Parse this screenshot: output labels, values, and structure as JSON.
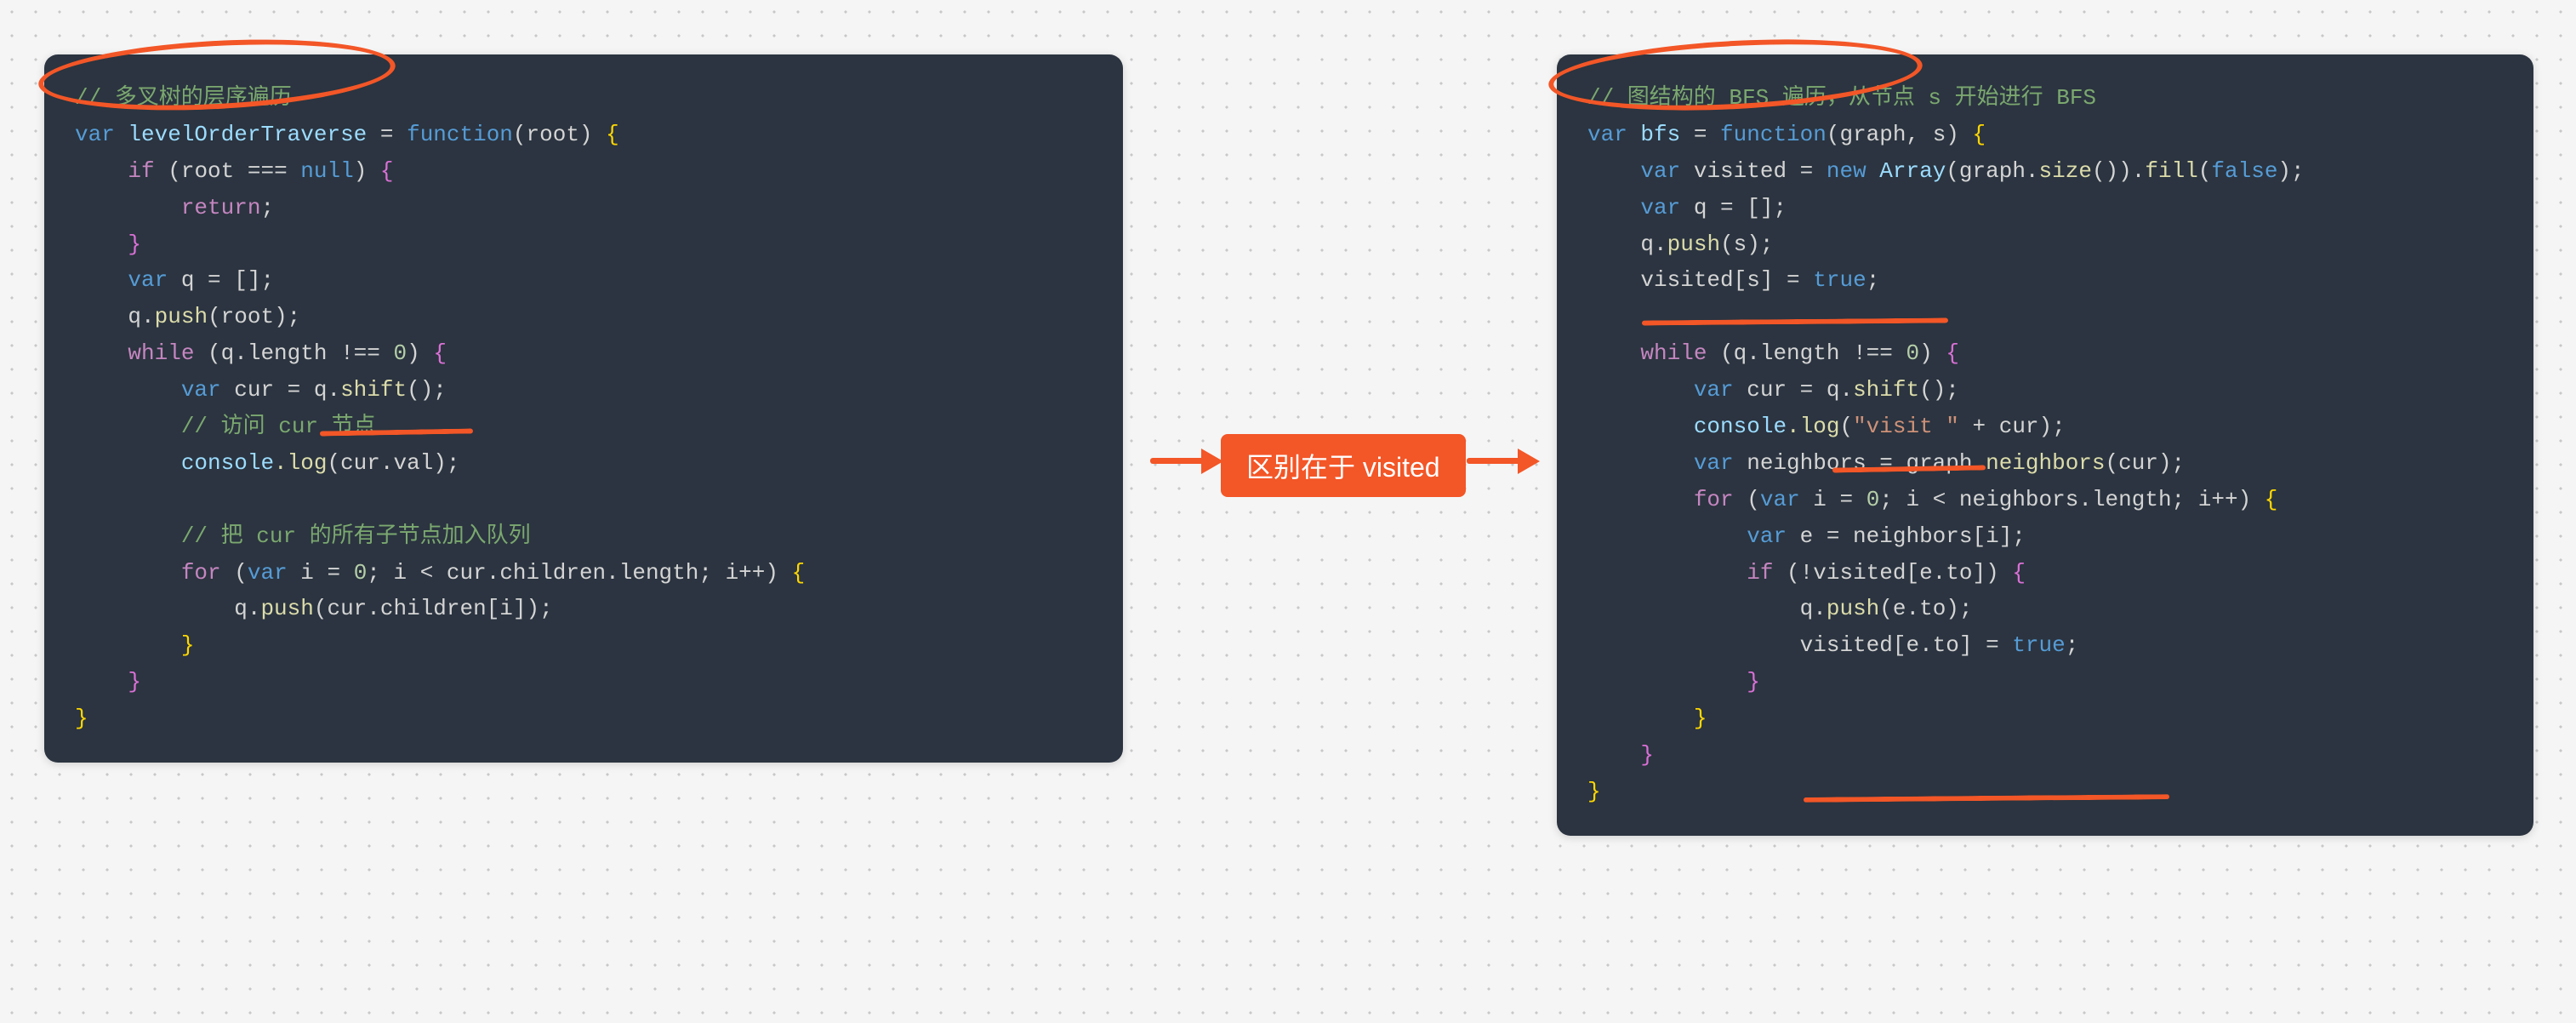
{
  "diagram": {
    "center_label": "区别在于 visited",
    "annotations": [
      {
        "type": "circle",
        "target": "left-comment-title"
      },
      {
        "type": "circle",
        "target": "right-comment-title"
      },
      {
        "type": "underline",
        "target": "left-q-shift"
      },
      {
        "type": "underline",
        "target": "right-visited-s-true"
      },
      {
        "type": "underline",
        "target": "right-q-shift"
      },
      {
        "type": "underline",
        "target": "right-visited-eto-true"
      },
      {
        "type": "arrow",
        "from": "left-block",
        "to": "center-label"
      },
      {
        "type": "arrow",
        "from": "center-label",
        "to": "right-block"
      }
    ]
  },
  "left_code": {
    "comment_title": "// 多叉树的层序遍历",
    "tokens": {
      "var": "var",
      "fn_name": "levelOrderTraverse",
      "eq": " = ",
      "function": "function",
      "args": "(root) ",
      "lb1": "{",
      "if": "if",
      "cond": " (root === ",
      "null": "null",
      "cond_end": ") ",
      "lb2": "{",
      "return": "return",
      "semi": ";",
      "rb2": "}",
      "q_decl_var": "var",
      "q_decl": " q = [];",
      "qpush": "q.",
      "push": "push",
      "qpush_arg": "(root);",
      "while": "while",
      "while_cond": " (q.length !== ",
      "zero": "0",
      "while_end": ") ",
      "lb3": "{",
      "cur_var": "var",
      "cur_decl": " cur = q.",
      "shift": "shift",
      "cur_end": "();",
      "comment_visit": "// 访问 cur 节点",
      "console": "console",
      "log": ".log",
      "log_arg": "(cur.val);",
      "comment_children": "// 把 cur 的所有子节点加入队列",
      "for": "for",
      "for_open": " (",
      "for_var": "var",
      "for_i": " i = ",
      "for_zero": "0",
      "for_cond": "; i < cur.children.length; i++) ",
      "lb4": "{",
      "qpush2": "q.",
      "push2": "push",
      "qpush2_arg": "(cur.children[i]);",
      "rb4": "}",
      "rb3": "}",
      "rb1": "}"
    }
  },
  "right_code": {
    "comment_title": "// 图结构的 BFS 遍历，从节点 s 开始进行 BFS",
    "tokens": {
      "var": "var",
      "fn_name": "bfs",
      "eq": " = ",
      "function": "function",
      "args": "(graph, s) ",
      "lb1": "{",
      "v_var": "var",
      "v_decl": " visited = ",
      "new": "new",
      "v_arr": " Array",
      "v_arr_arg": "(graph.",
      "size": "size",
      "v_arr_end": "()).",
      "fill": "fill",
      "v_fill_open": "(",
      "false": "false",
      "v_fill_end": ");",
      "q_var": "var",
      "q_decl": " q = [];",
      "qpush": "q.",
      "push": "push",
      "qpush_arg": "(s);",
      "vis_s": "visited[s] = ",
      "true": "true",
      "vis_s_end": ";",
      "while": "while",
      "while_cond": " (q.length !== ",
      "zero": "0",
      "while_end": ") ",
      "lb2": "{",
      "cur_var": "var",
      "cur_decl": " cur = q.",
      "shift": "shift",
      "cur_end": "();",
      "console": "console",
      "log": ".log",
      "log_open": "(",
      "str": "\"visit \"",
      "log_plus": " + cur);",
      "n_var": "var",
      "n_decl": " neighbors = graph.",
      "neighbors_fn": "neighbors",
      "n_arg": "(cur);",
      "for": "for",
      "for_open": " (",
      "for_var": "var",
      "for_i": " i = ",
      "for_zero": "0",
      "for_cond": "; i < neighbors.length; i++) ",
      "lb3": "{",
      "e_var": "var",
      "e_decl": " e = neighbors[i];",
      "if": "if",
      "if_cond": " (!visited[e.to]) ",
      "lb4": "{",
      "qpush2": "q.",
      "push2": "push",
      "qpush2_arg": "(e.to);",
      "vis_eto": "visited[e.to] = ",
      "true2": "true",
      "vis_eto_end": ";",
      "rb4": "}",
      "rb3": "}",
      "rb2": "}",
      "rb1": "}"
    }
  }
}
